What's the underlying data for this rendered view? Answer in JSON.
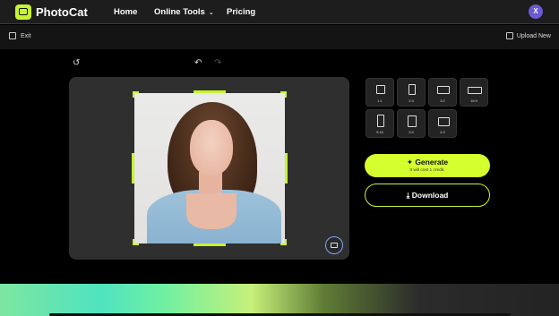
{
  "nav": {
    "brand": "PhotoCat",
    "home": "Home",
    "tools": "Online Tools",
    "tools_chevron": "⌄",
    "pricing": "Pricing",
    "avatar_initial": "X"
  },
  "subbar": {
    "exit": "Exit",
    "upload": "Upload New"
  },
  "tools": {
    "rotate_icon": "↺",
    "undo_icon": "↶",
    "redo_icon": "↷"
  },
  "ratios": [
    {
      "label": "1:1"
    },
    {
      "label": "2:3"
    },
    {
      "label": "3:2"
    },
    {
      "label": "16:9"
    },
    {
      "label": "9:16"
    },
    {
      "label": "3:4"
    },
    {
      "label": "4:3"
    }
  ],
  "actions": {
    "generate_label": "Generate",
    "generate_sub": "It will cost 1 credit.",
    "download_label": "Download"
  },
  "colors": {
    "accent": "#c6f432",
    "avatar": "#6a5ad3"
  }
}
